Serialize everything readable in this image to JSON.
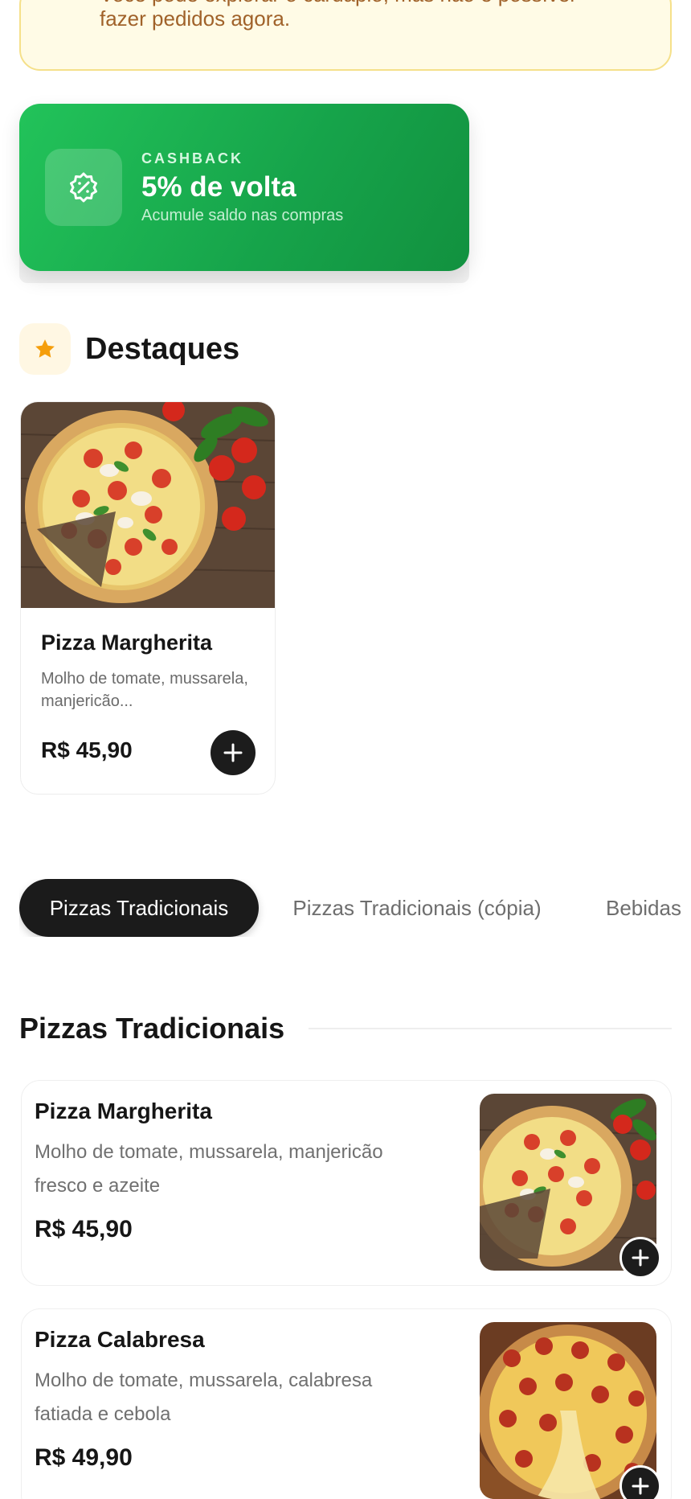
{
  "notice": {
    "line1": "Você pode explorar o cardápio, mas não é possível",
    "line2": "fazer pedidos agora."
  },
  "cashback": {
    "eyebrow": "CASHBACK",
    "title": "5% de volta",
    "subtitle": "Acumule saldo nas compras",
    "icon": "percent-badge-icon"
  },
  "highlights": {
    "title": "Destaques",
    "icon": "star-icon",
    "items": [
      {
        "name": "Pizza Margherita",
        "description": "Molho de tomate, mussarela, manjericão...",
        "price": "R$ 45,90",
        "image": "pizza-margherita-photo"
      }
    ]
  },
  "tabs": [
    {
      "label": "Pizzas Tradicionais",
      "active": true
    },
    {
      "label": "Pizzas Tradicionais (cópia)",
      "active": false
    },
    {
      "label": "Bebidas",
      "active": false
    }
  ],
  "category": {
    "title": "Pizzas Tradicionais",
    "items": [
      {
        "name": "Pizza Margherita",
        "description": "Molho de tomate, mussarela, manjericão fresco e azeite",
        "price": "R$ 45,90",
        "image": "pizza-margherita-photo"
      },
      {
        "name": "Pizza Calabresa",
        "description": "Molho de tomate, mussarela, calabresa fatiada e cebola",
        "price": "R$ 49,90",
        "image": "pizza-calabresa-photo"
      }
    ]
  },
  "colors": {
    "accent_green": "#16a34a",
    "notice_bg": "#fffbe6",
    "notice_text": "#a0622a",
    "dark": "#1b1b1b",
    "star": "#f59e0b"
  }
}
